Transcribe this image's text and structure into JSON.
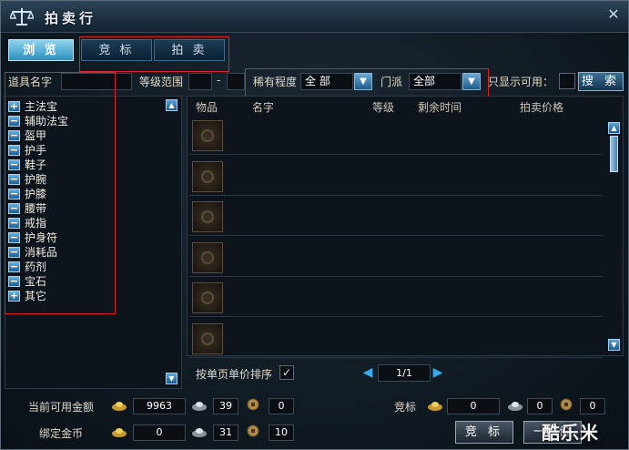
{
  "window": {
    "title": "拍卖行",
    "close_glyph": "✕"
  },
  "tabs": [
    {
      "label": "浏 览",
      "active": true
    },
    {
      "label": "竞 标",
      "active": false
    },
    {
      "label": "拍 卖",
      "active": false
    }
  ],
  "filters": {
    "item_name_label": "道具名字",
    "item_name_value": "",
    "level_range_label": "等级范围",
    "level_min": "",
    "level_sep": "-",
    "level_max": "",
    "rarity_label": "稀有程度",
    "rarity_value": "全 部",
    "faction_label": "门派",
    "faction_value": "全部",
    "only_usable_label": "只显示可用：",
    "search_label": "搜 索"
  },
  "categories": [
    {
      "label": "主法宝",
      "expander": "+"
    },
    {
      "label": "辅助法宝",
      "expander": "−"
    },
    {
      "label": "盔甲",
      "expander": "−"
    },
    {
      "label": "护手",
      "expander": "−"
    },
    {
      "label": "鞋子",
      "expander": "−"
    },
    {
      "label": "护腕",
      "expander": "−"
    },
    {
      "label": "护膝",
      "expander": "−"
    },
    {
      "label": "腰带",
      "expander": "−"
    },
    {
      "label": "戒指",
      "expander": "−"
    },
    {
      "label": "护身符",
      "expander": "−"
    },
    {
      "label": "消耗品",
      "expander": "−"
    },
    {
      "label": "药剂",
      "expander": "−"
    },
    {
      "label": "宝石",
      "expander": "−"
    },
    {
      "label": "其它",
      "expander": "+"
    }
  ],
  "columns": {
    "item": "物品",
    "name": "名字",
    "level": "等级",
    "time_left": "剩余时间",
    "price": "拍卖价格"
  },
  "listing_slots": 6,
  "sort": {
    "label": "按单页单价排序",
    "checked": true,
    "check_glyph": "✓"
  },
  "pagination": {
    "page": "1/1",
    "prev_glyph": "◀",
    "next_glyph": "▶"
  },
  "money": {
    "available_label": "当前可用金额",
    "available_gold": "9963",
    "available_silver": "39",
    "available_copper": "0",
    "bound_label": "绑定金币",
    "bound_gold": "0",
    "bound_silver": "31",
    "bound_copper": "10",
    "bid_label": "竞标",
    "bid_gold": "0",
    "bid_silver": "0",
    "bid_copper": "0"
  },
  "actions": {
    "bid_button": "竞 标",
    "buyout_button": "一口价"
  },
  "watermark": "酷乐米",
  "colors": {
    "accent": "#2d8fbf",
    "highlight_box": "#dd2222"
  }
}
